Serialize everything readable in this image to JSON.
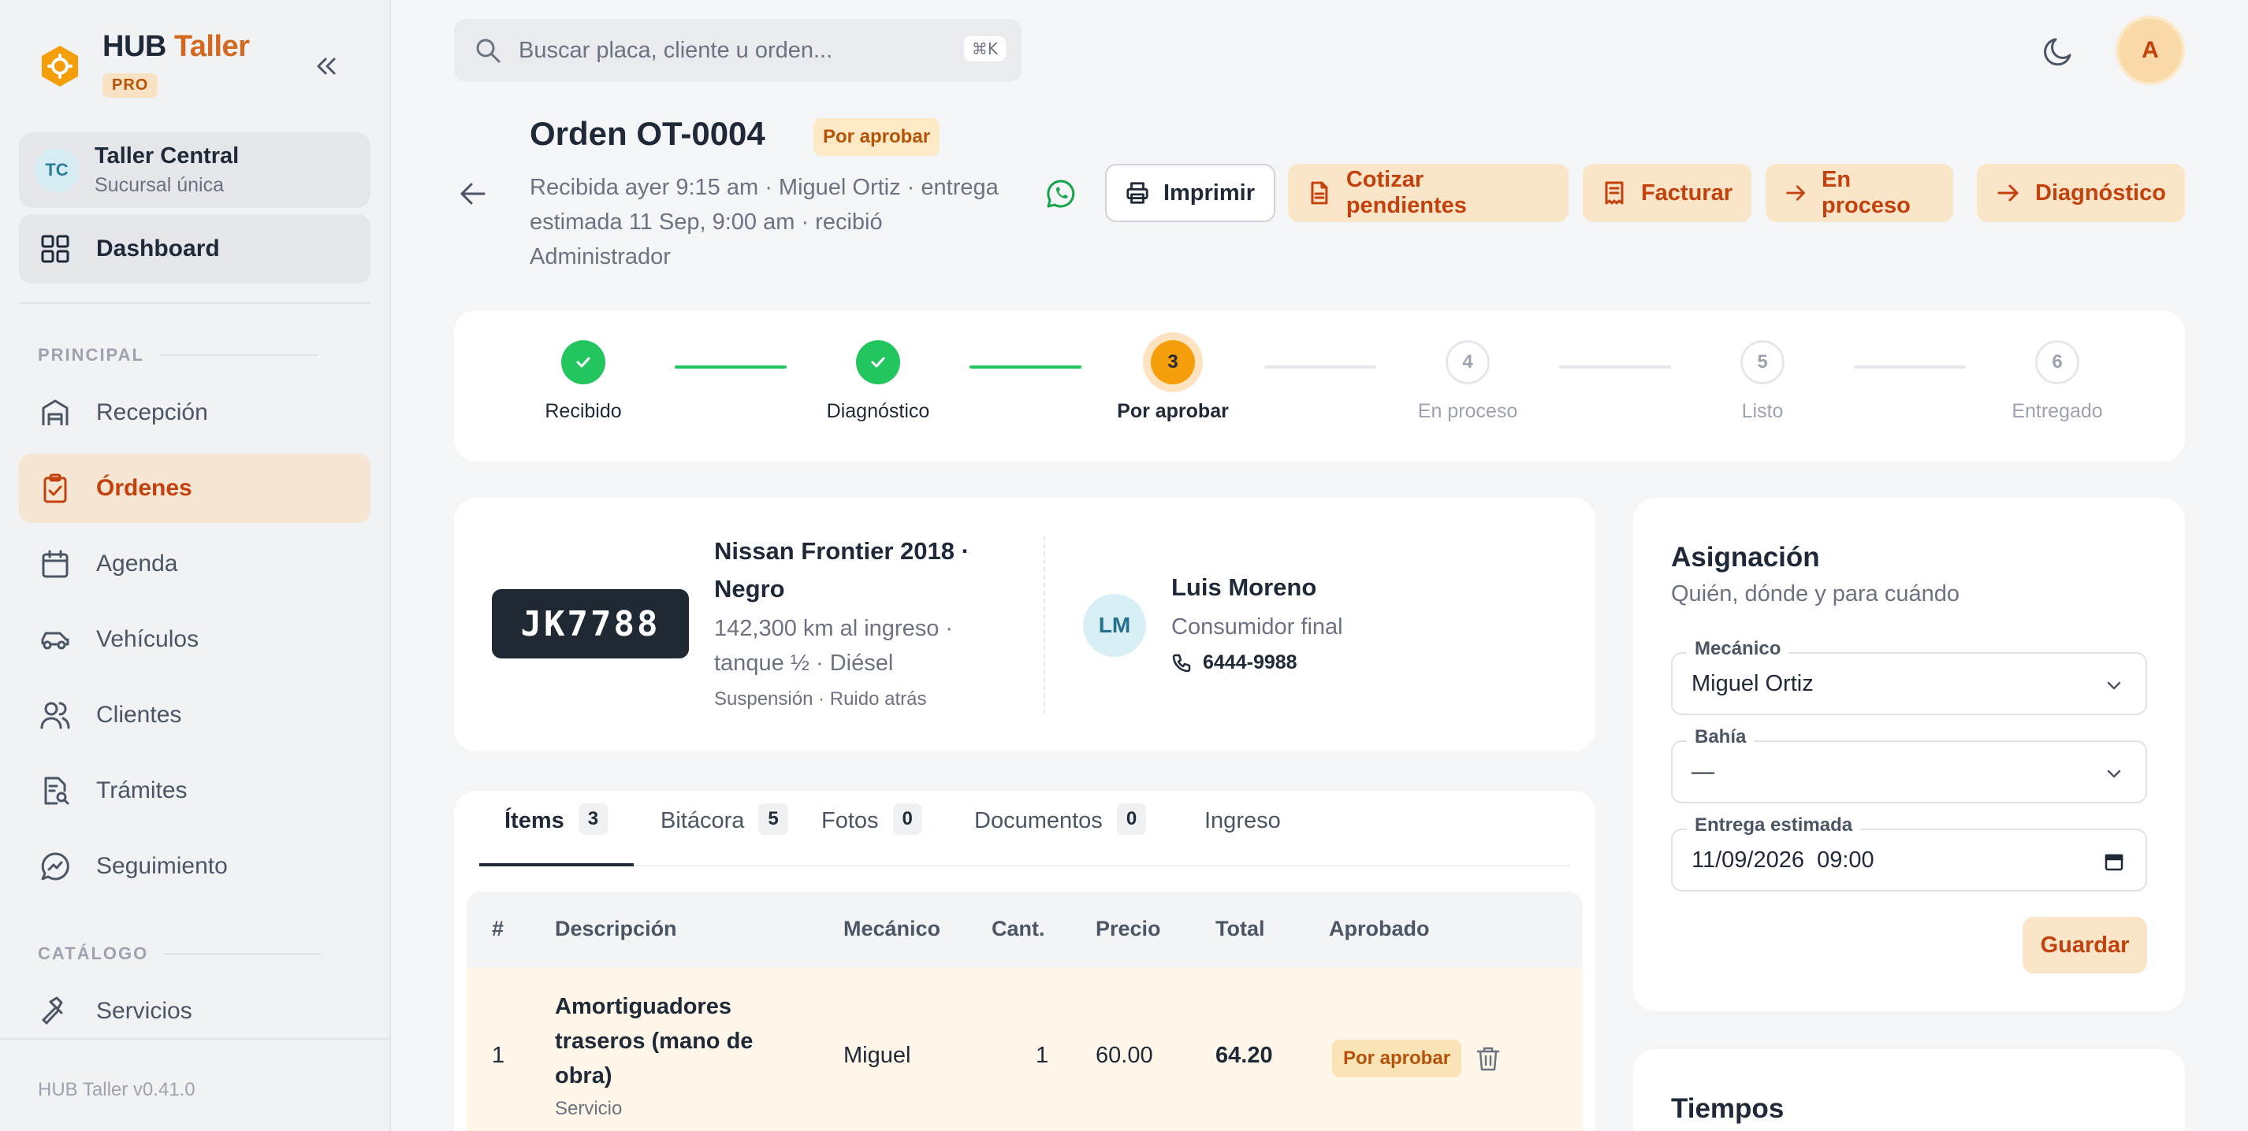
{
  "brand": {
    "name_part1": "HUB",
    "name_part2": "Taller",
    "badge": "PRO"
  },
  "branch": {
    "initials": "TC",
    "name": "Taller Central",
    "subtitle": "Sucursal única"
  },
  "sidebar": {
    "dashboard": "Dashboard",
    "section_principal": "PRINCIPAL",
    "section_catalogo": "CATÁLOGO",
    "items": [
      {
        "label": "Recepción",
        "icon": "garage-icon"
      },
      {
        "label": "Órdenes",
        "icon": "clipboard-check-icon",
        "active": true
      },
      {
        "label": "Agenda",
        "icon": "calendar-icon"
      },
      {
        "label": "Vehículos",
        "icon": "car-icon"
      },
      {
        "label": "Clientes",
        "icon": "users-icon"
      },
      {
        "label": "Trámites",
        "icon": "file-search-icon"
      },
      {
        "label": "Seguimiento",
        "icon": "chat-chart-icon"
      },
      {
        "label": "Servicios",
        "icon": "hammer-icon"
      }
    ],
    "version": "HUB Taller v0.41.0"
  },
  "search": {
    "placeholder": "Buscar placa, cliente u orden...",
    "shortcut": "⌘K"
  },
  "user": {
    "initial": "A"
  },
  "order": {
    "title": "Orden OT-0004",
    "status": "Por aprobar",
    "meta": "Recibida ayer 9:15 am · Miguel Ortiz · entrega estimada 11 Sep, 9:00 am · recibió Administrador",
    "actions": {
      "print": "Imprimir",
      "quote": "Cotizar pendientes",
      "invoice": "Facturar",
      "in_process": "En proceso",
      "diagnosis": "Diagnóstico"
    }
  },
  "stepper": {
    "steps": [
      {
        "num": "1",
        "label": "Recibido",
        "state": "done"
      },
      {
        "num": "2",
        "label": "Diagnóstico",
        "state": "done"
      },
      {
        "num": "3",
        "label": "Por aprobar",
        "state": "current"
      },
      {
        "num": "4",
        "label": "En proceso",
        "state": "pending"
      },
      {
        "num": "5",
        "label": "Listo",
        "state": "pending"
      },
      {
        "num": "6",
        "label": "Entregado",
        "state": "pending"
      }
    ]
  },
  "vehicle": {
    "plate": "JK7788",
    "name": "Nissan Frontier 2018 · Negro",
    "meta": "142,300 km al ingreso · tanque ½ · Diésel",
    "reason": "Suspensión · Ruido atrás"
  },
  "client": {
    "initials": "LM",
    "name": "Luis Moreno",
    "type": "Consumidor final",
    "phone": "6444-9988"
  },
  "tabs": [
    {
      "label": "Ítems",
      "count": "3",
      "active": true
    },
    {
      "label": "Bitácora",
      "count": "5"
    },
    {
      "label": "Fotos",
      "count": "0"
    },
    {
      "label": "Documentos",
      "count": "0"
    },
    {
      "label": "Ingreso",
      "count": ""
    }
  ],
  "table": {
    "headers": {
      "num": "#",
      "desc": "Descripción",
      "mechanic": "Mecánico",
      "qty": "Cant.",
      "price": "Precio",
      "total": "Total",
      "approved": "Aprobado"
    },
    "rows": [
      {
        "num": "1",
        "name": "Amortiguadores traseros (mano de obra)",
        "type": "Servicio",
        "mechanic": "Miguel",
        "qty": "1",
        "price": "60.00",
        "total": "64.20",
        "approved": "Por aprobar"
      }
    ]
  },
  "assignment": {
    "title": "Asignación",
    "subtitle": "Quién, dónde y para cuándo",
    "mechanic_label": "Mecánico",
    "mechanic_value": "Miguel Ortiz",
    "bay_label": "Bahía",
    "bay_value": "—",
    "delivery_label": "Entrega estimada",
    "delivery_value": "11/09/2026  09:00",
    "save": "Guardar"
  },
  "times": {
    "title": "Tiempos"
  },
  "colors": {
    "accent": "#c2410c",
    "accent_soft": "#fbe5c8",
    "success": "#22c55e",
    "warning": "#f59e0b"
  }
}
